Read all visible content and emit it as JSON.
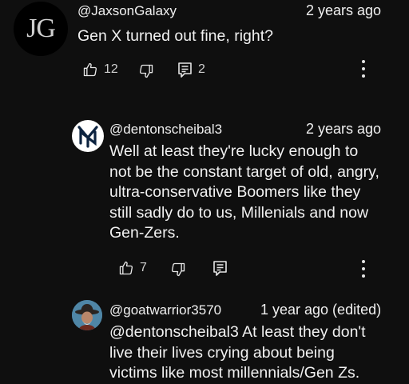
{
  "comments": [
    {
      "avatar_text": "JG",
      "handle": "@JaxsonGalaxy",
      "time": "2 years ago",
      "text": "Gen X turned out fine, right?",
      "likes": "12",
      "replies": "2"
    },
    {
      "handle": "@dentonscheibal3",
      "time": "2 years ago",
      "lines": [
        "Well at least they're lucky enough to",
        "not be the constant target of old, angry,",
        "ultra-conservative Boomers like they",
        "still sadly do to us, Millenials and now",
        "Gen-Zers."
      ],
      "likes": "7"
    },
    {
      "handle": "@goatwarrior3570",
      "time": "1 year ago (edited)",
      "lines": [
        "@dentonscheibal3 At least they don't",
        "live their lives crying about being",
        "victims like most millennials/Gen Zs."
      ]
    }
  ],
  "icons": {
    "like": "thumbs-up-icon",
    "dislike": "thumbs-down-icon",
    "reply": "reply-icon",
    "more": "more-vert-icon"
  }
}
